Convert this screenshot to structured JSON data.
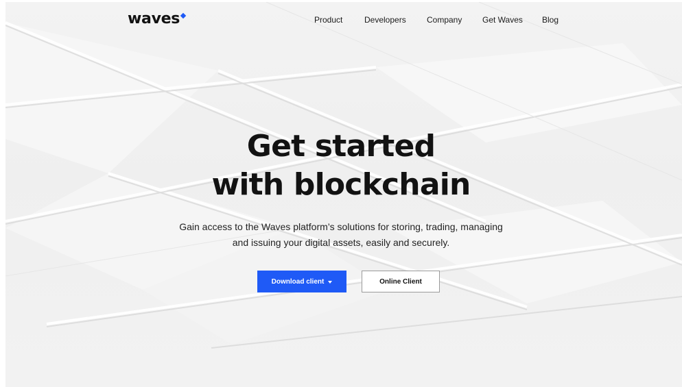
{
  "header": {
    "logo_text": "waves",
    "nav": [
      {
        "label": "Product"
      },
      {
        "label": "Developers"
      },
      {
        "label": "Company"
      },
      {
        "label": "Get Waves"
      },
      {
        "label": "Blog"
      }
    ]
  },
  "hero": {
    "title_line1": "Get started",
    "title_line2": "with blockchain",
    "subtitle_line1": "Gain access to the Waves platform’s solutions for storing, trading, managing",
    "subtitle_line2": "and issuing your digital assets, easily and securely.",
    "primary_button": "Download client",
    "secondary_button": "Online Client"
  },
  "colors": {
    "accent": "#1f5af6",
    "background": "#f0f0f0",
    "text": "#121212"
  }
}
